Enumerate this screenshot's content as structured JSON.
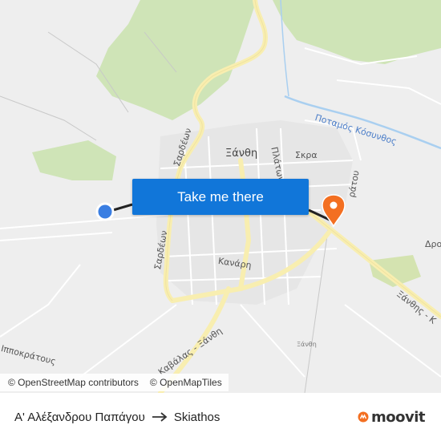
{
  "map": {
    "labels": {
      "xanthi": "Ξάνθη",
      "river": "Ποταμός Κόσυνθος",
      "skra": "Σκρα",
      "plastira": "Πλάτωνος",
      "sardeon_top": "Σαρδέων",
      "sardeon_bottom": "Σαρδέων",
      "kanari": "Κανάρη",
      "hippocratous": "Ιπποκράτους",
      "kavalas_xanthis": "Καβάλας - Ξάνθη",
      "xanthis_highway": "Ξάνθης - Κ",
      "xanthi_small": "Ξάνθη",
      "dro": "Δρο",
      "lratou": "ράτου"
    },
    "colors": {
      "route": "#222222",
      "origin": "#3a7ee2",
      "destination": "#f36f21",
      "major_road": "#f8eeb0",
      "park": "#cfe4b7",
      "water": "#a9cff0"
    }
  },
  "cta": {
    "label": "Take me there"
  },
  "attribution": {
    "osm": "© OpenStreetMap contributors",
    "omt": "© OpenMapTiles"
  },
  "footer": {
    "origin": "Α' Αλέξανδρου Παπάγου",
    "destination": "Skiathos",
    "brand": "moovit"
  }
}
